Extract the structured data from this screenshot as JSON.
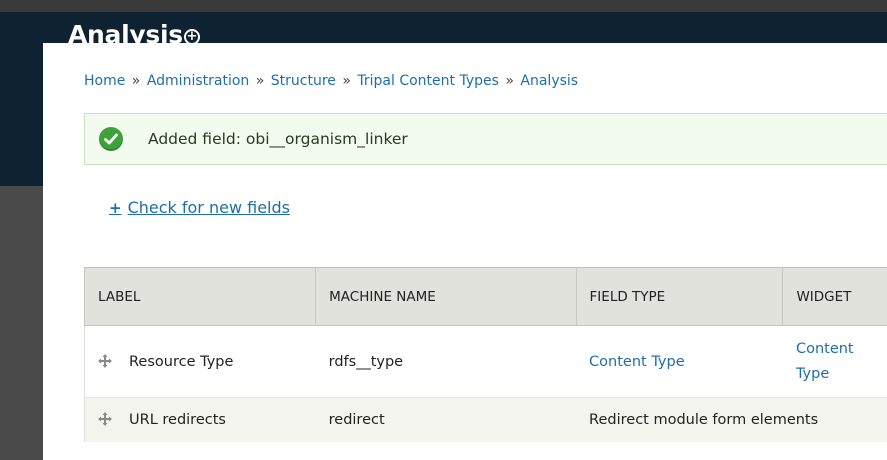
{
  "header": {
    "title": "Analysis",
    "shortcut_icon": "add-shortcut-icon"
  },
  "breadcrumb": {
    "items": [
      "Home",
      "Administration",
      "Structure",
      "Tripal Content Types",
      "Analysis"
    ],
    "separator": "»"
  },
  "message": {
    "icon": "checkmark-icon",
    "text": "Added field: obi__organism_linker",
    "color": "#3da23a"
  },
  "actions": {
    "check_fields_label": "Check for new fields",
    "plus": "+"
  },
  "table": {
    "headers": [
      "LABEL",
      "MACHINE NAME",
      "FIELD TYPE",
      "WIDGET"
    ],
    "rows": [
      {
        "label": "Resource Type",
        "machine_name": "rdfs__type",
        "field_type": "Content Type",
        "widget": "Content Type",
        "widget_line1": "Content",
        "widget_line2": "Type"
      },
      {
        "label": "URL redirects",
        "machine_name": "redirect",
        "field_type": "Redirect module form elements",
        "widget": ""
      }
    ]
  },
  "colors": {
    "header_bg": "#0f2231",
    "link": "#1f6fa7",
    "table_header_bg": "#e1e2dc",
    "message_bg": "#f3faef"
  }
}
